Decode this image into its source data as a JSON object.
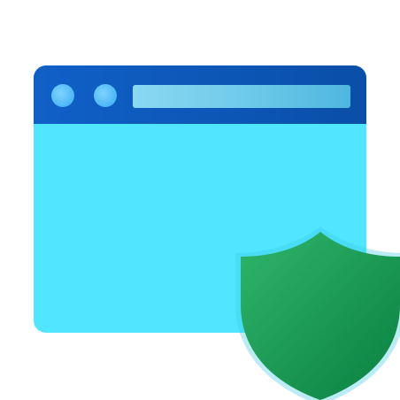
{
  "icon": {
    "name": "browser-window-security-icon",
    "colors": {
      "window_body": "#50e6ff",
      "titlebar": "#0a4fa8",
      "address_bar": "#6fcbe9",
      "window_button": "#4cb6f5",
      "shield_light": "#2fb56a",
      "shield_dark": "#0a8040"
    },
    "parts": [
      "browser-window-icon",
      "shield-icon"
    ]
  }
}
